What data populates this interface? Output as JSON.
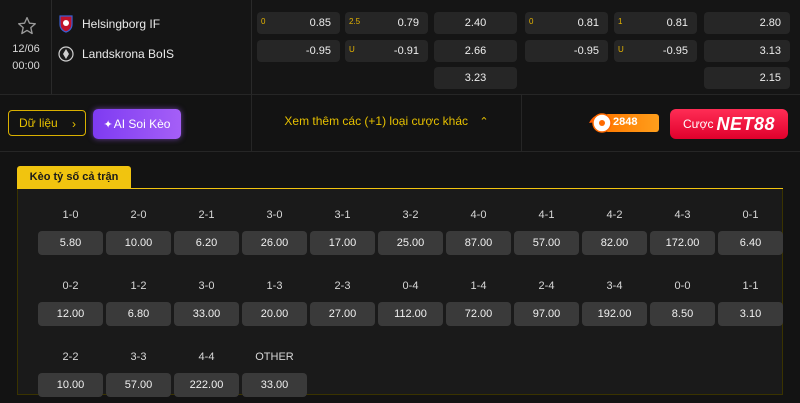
{
  "match": {
    "date": "12/06",
    "time": "00:00",
    "home": "Helsingborg IF",
    "away": "Landskrona BoIS"
  },
  "odds": {
    "ah1": {
      "home_line": "0",
      "home": "0.85",
      "away": "-0.95"
    },
    "ou1": {
      "over_line": "2.5",
      "over": "0.79",
      "under_line": "U",
      "under": "-0.91"
    },
    "x12_1": [
      "2.40",
      "2.66",
      "3.23"
    ],
    "ah2": {
      "home_line": "0",
      "home": "0.81",
      "away": "-0.95"
    },
    "ou2": {
      "over_line": "1",
      "over": "0.81",
      "under_line": "U",
      "under": "-0.95"
    },
    "x12_2": [
      "2.80",
      "3.13",
      "2.15"
    ]
  },
  "actions": {
    "data_label": "Dữ liệu",
    "ai_label": "AI Soi Kèo",
    "more_bets": "Xem thêm các (+1) loại cược khác",
    "brand_num": "2848",
    "net_prefix": "Cược",
    "net_brand": "NET88"
  },
  "colors": {
    "accent": "#f1c40f",
    "ai": "#8b46f4",
    "net88": "#ff1f4b",
    "orange": "#ff7a00"
  },
  "correct_score": {
    "tab": "Kèo tỷ số cả trận",
    "rows": [
      [
        {
          "s": "1-0",
          "o": "5.80"
        },
        {
          "s": "2-0",
          "o": "10.00"
        },
        {
          "s": "2-1",
          "o": "6.20"
        },
        {
          "s": "3-0",
          "o": "26.00"
        },
        {
          "s": "3-1",
          "o": "17.00"
        },
        {
          "s": "3-2",
          "o": "25.00"
        },
        {
          "s": "4-0",
          "o": "87.00"
        },
        {
          "s": "4-1",
          "o": "57.00"
        },
        {
          "s": "4-2",
          "o": "82.00"
        },
        {
          "s": "4-3",
          "o": "172.00"
        },
        {
          "s": "0-1",
          "o": "6.40"
        }
      ],
      [
        {
          "s": "0-2",
          "o": "12.00"
        },
        {
          "s": "1-2",
          "o": "6.80"
        },
        {
          "s": "3-0",
          "o": "33.00"
        },
        {
          "s": "1-3",
          "o": "20.00"
        },
        {
          "s": "2-3",
          "o": "27.00"
        },
        {
          "s": "0-4",
          "o": "112.00"
        },
        {
          "s": "1-4",
          "o": "72.00"
        },
        {
          "s": "2-4",
          "o": "97.00"
        },
        {
          "s": "3-4",
          "o": "192.00"
        },
        {
          "s": "0-0",
          "o": "8.50"
        },
        {
          "s": "1-1",
          "o": "3.10"
        }
      ],
      [
        {
          "s": "2-2",
          "o": "10.00"
        },
        {
          "s": "3-3",
          "o": "57.00"
        },
        {
          "s": "4-4",
          "o": "222.00"
        },
        {
          "s": "OTHER",
          "o": "33.00"
        }
      ]
    ]
  }
}
